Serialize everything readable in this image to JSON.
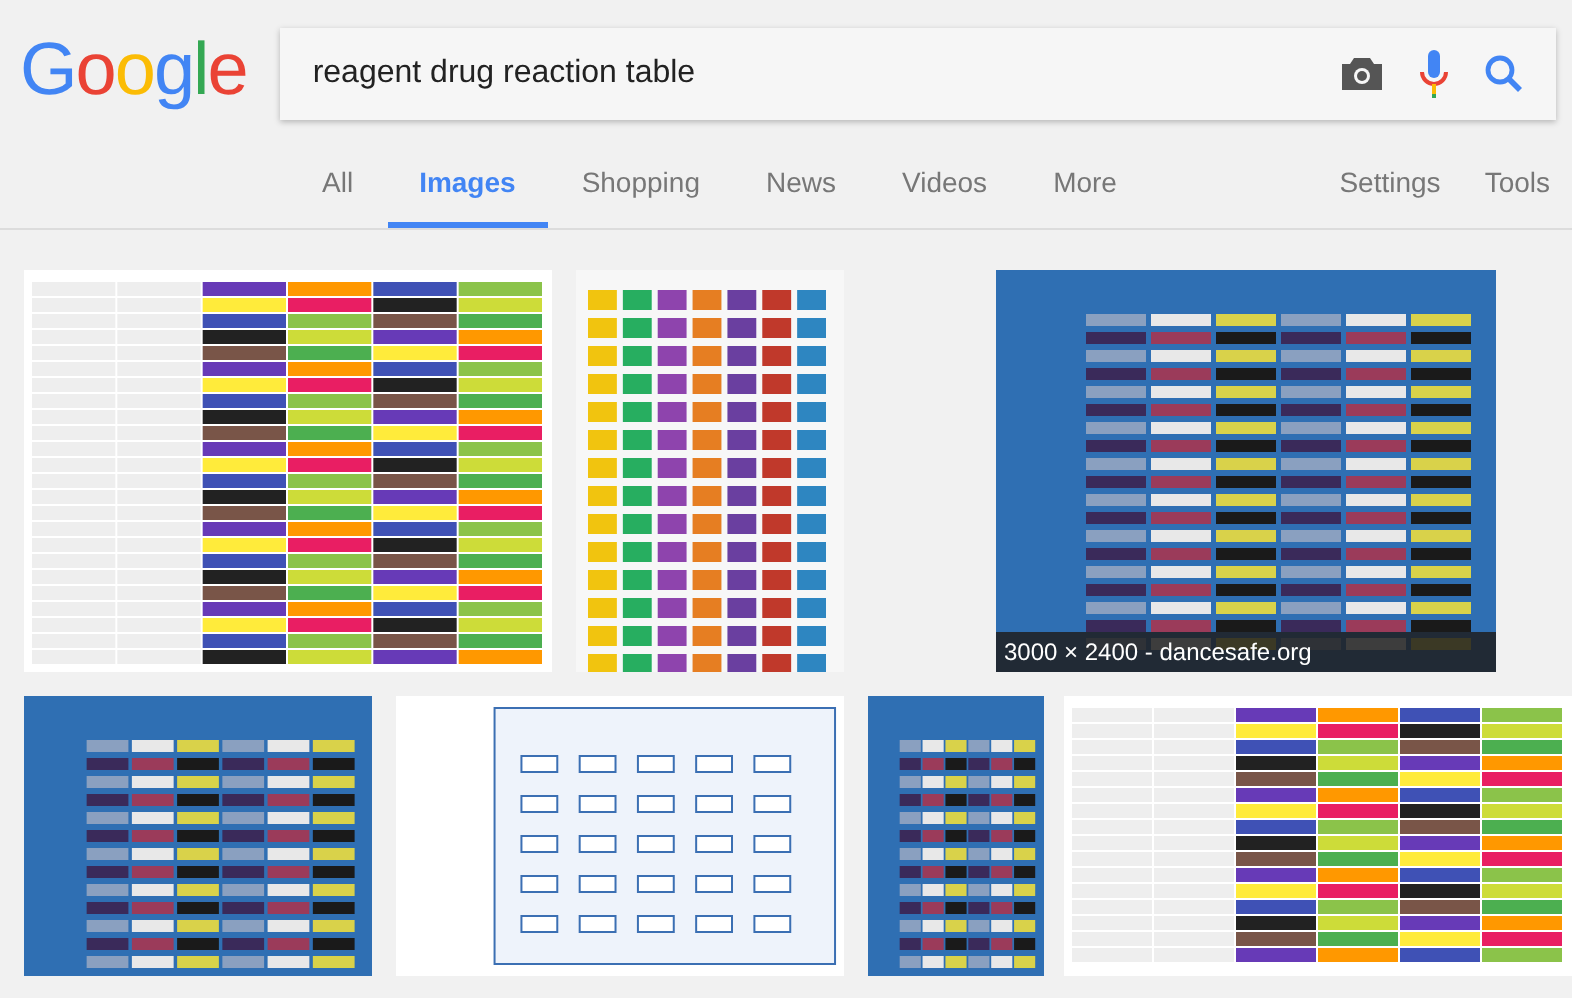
{
  "logo": "Google",
  "search": {
    "value": "reagent drug reaction table"
  },
  "tabs": [
    {
      "label": "All",
      "selected": false
    },
    {
      "label": "Images",
      "selected": true
    },
    {
      "label": "Shopping",
      "selected": false
    },
    {
      "label": "News",
      "selected": false
    },
    {
      "label": "Videos",
      "selected": false
    },
    {
      "label": "More",
      "selected": false
    }
  ],
  "tools": [
    "Settings",
    "Tools"
  ],
  "results": [
    [
      {
        "kind": "table"
      },
      {
        "kind": "chart"
      },
      {
        "kind": "poster",
        "caption": "3000 × 2400 - dancesafe.org"
      }
    ],
    [
      {
        "kind": "poster"
      },
      {
        "kind": "diagram"
      },
      {
        "kind": "poster"
      },
      {
        "kind": "table"
      }
    ]
  ]
}
